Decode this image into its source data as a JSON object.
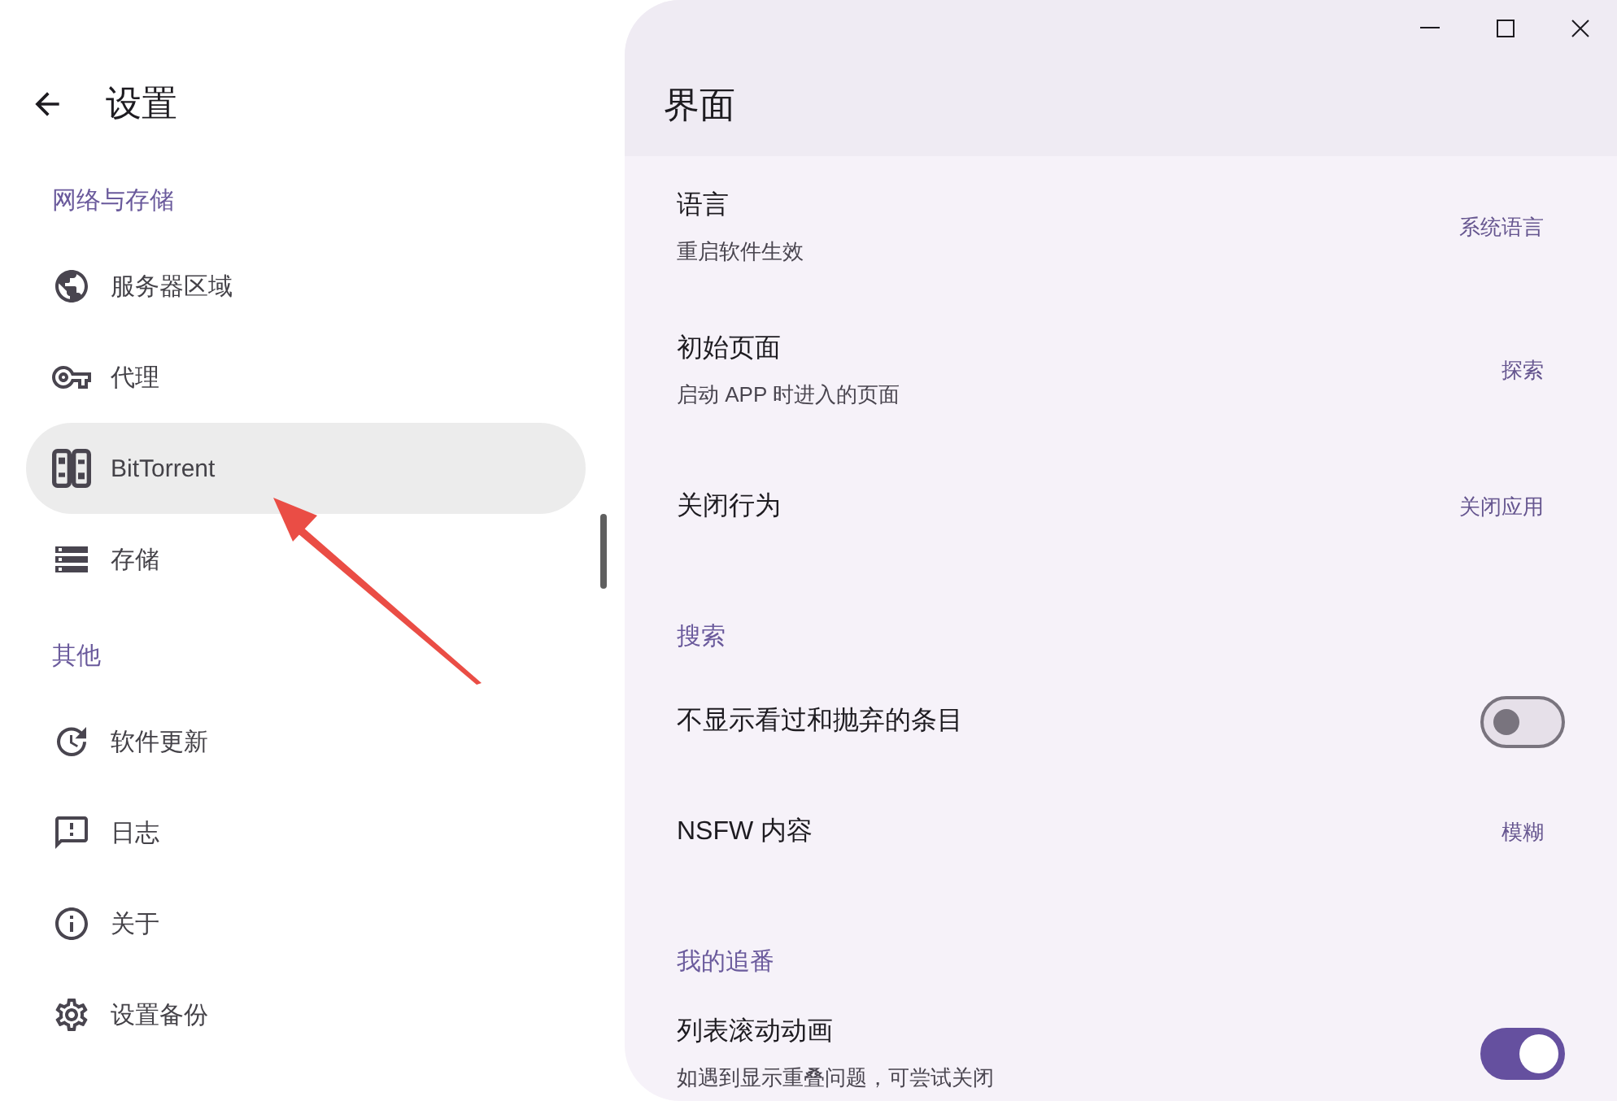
{
  "sidebar": {
    "title": "设置",
    "sections": [
      {
        "heading": "网络与存储",
        "items": [
          {
            "label": "服务器区域",
            "selected": false
          },
          {
            "label": "代理",
            "selected": false
          },
          {
            "label": "BitTorrent",
            "selected": true
          },
          {
            "label": "存储",
            "selected": false
          }
        ]
      },
      {
        "heading": "其他",
        "items": [
          {
            "label": "软件更新",
            "selected": false
          },
          {
            "label": "日志",
            "selected": false
          },
          {
            "label": "关于",
            "selected": false
          },
          {
            "label": "设置备份",
            "selected": false
          }
        ]
      }
    ]
  },
  "page": {
    "title": "界面",
    "sections": [
      {
        "rows": [
          {
            "kind": "value",
            "title": "语言",
            "subtitle": "重启软件生效",
            "value": "系统语言"
          },
          {
            "kind": "value",
            "title": "初始页面",
            "subtitle": "启动 APP 时进入的页面",
            "value": "探索"
          },
          {
            "kind": "value",
            "title": "关闭行为",
            "value": "关闭应用"
          }
        ]
      },
      {
        "heading": "搜索",
        "rows": [
          {
            "kind": "toggle",
            "title": "不显示看过和抛弃的条目",
            "on": false
          },
          {
            "kind": "value",
            "title": "NSFW 内容",
            "value": "模糊"
          }
        ]
      },
      {
        "heading": "我的追番",
        "rows": [
          {
            "kind": "toggle",
            "title": "列表滚动动画",
            "subtitle": "如遇到显示重叠问题，可尝试关闭",
            "on": true
          }
        ]
      }
    ]
  }
}
